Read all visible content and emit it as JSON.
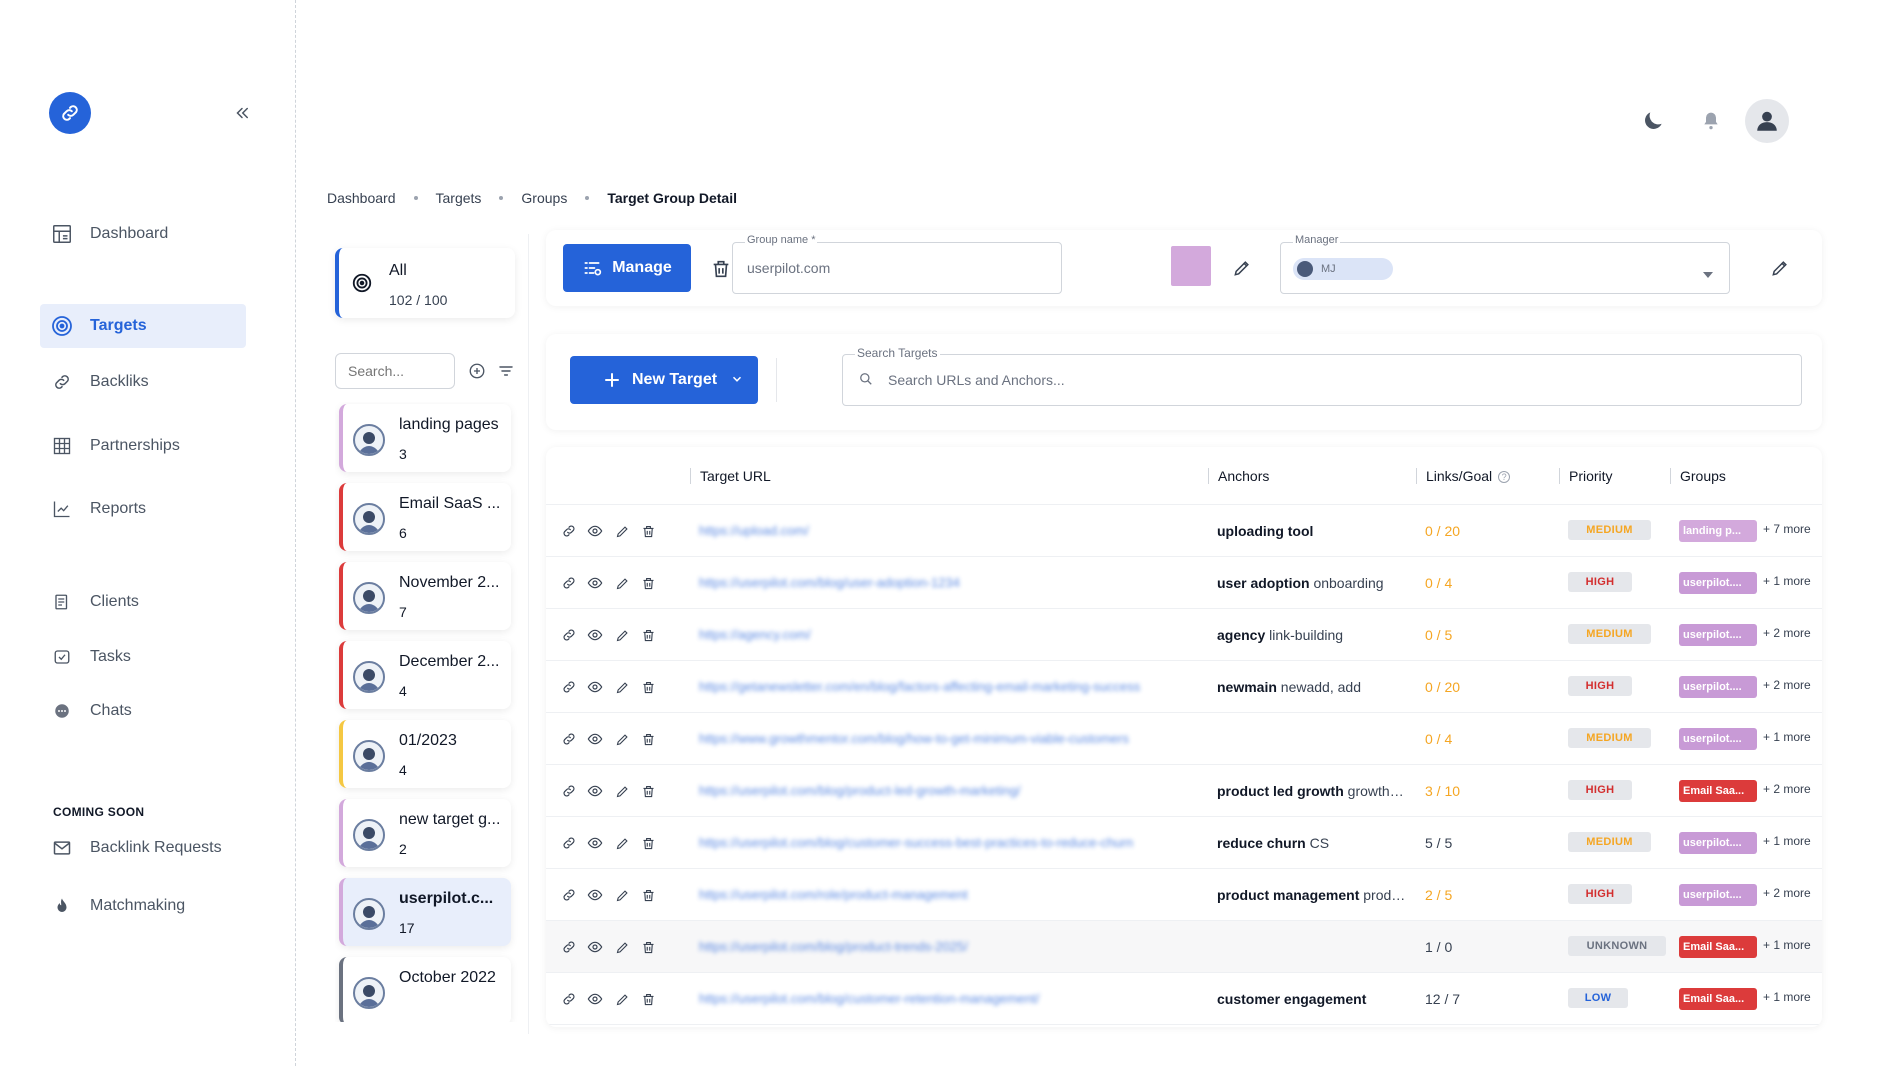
{
  "sidebar": {
    "items": [
      {
        "label": "Dashboard",
        "icon": "dashboard-icon"
      },
      {
        "label": "Targets",
        "icon": "target-icon",
        "active": true
      },
      {
        "label": "Backliks",
        "icon": "link-icon"
      },
      {
        "label": "Partnerships",
        "icon": "grid-icon"
      },
      {
        "label": "Reports",
        "icon": "chart-icon"
      },
      {
        "label": "Clients",
        "icon": "clients-icon"
      },
      {
        "label": "Tasks",
        "icon": "tasks-icon"
      },
      {
        "label": "Chats",
        "icon": "chat-icon"
      }
    ],
    "coming_soon_title": "COMING SOON",
    "coming_soon": [
      {
        "label": "Backlink Requests",
        "icon": "mail-icon"
      },
      {
        "label": "Matchmaking",
        "icon": "flame-icon"
      }
    ]
  },
  "breadcrumb": [
    "Dashboard",
    "Targets",
    "Groups",
    "Target Group Detail"
  ],
  "groups": {
    "all_label": "All",
    "all_count": "102 / 100",
    "search_placeholder": "Search...",
    "list": [
      {
        "name": "landing pages",
        "count": "3",
        "color": "#d3a9dc"
      },
      {
        "name": "Email SaaS ...",
        "count": "6",
        "color": "#dc3b3b"
      },
      {
        "name": "November 2...",
        "count": "7",
        "color": "#dc3b3b"
      },
      {
        "name": "December 2...",
        "count": "4",
        "color": "#dc3b3b"
      },
      {
        "name": "01/2023",
        "count": "4",
        "color": "#f5c842"
      },
      {
        "name": "new target g...",
        "count": "2",
        "color": "#d3a9dc"
      },
      {
        "name": "userpilot.c...",
        "count": "17",
        "color": "#d3a9dc",
        "selected": true
      },
      {
        "name": "October 2022",
        "count": "",
        "color": "#6b7280"
      }
    ]
  },
  "header": {
    "manage_label": "Manage",
    "group_name_label": "Group name *",
    "group_name_value": "userpilot.com",
    "group_color": "#d3a9dc",
    "manager_label": "Manager",
    "manager_value": "MJ"
  },
  "actions": {
    "new_target_label": "New Target",
    "search_label": "Search Targets",
    "search_placeholder": "Search URLs and Anchors..."
  },
  "table": {
    "columns": [
      "Target URL",
      "Anchors",
      "Links/Goal",
      "Priority",
      "Groups"
    ],
    "rows": [
      {
        "url": "https://upload.com/",
        "anchor_bold": "uploading tool",
        "anchor_rest": "",
        "links": "0 / 20",
        "links_color": "#f5a623",
        "priority": "MEDIUM",
        "group": "landing p...",
        "group_color": "#d3a9dc",
        "more": "+ 7 more"
      },
      {
        "url": "https://userpilot.com/blog/user-adoption-1234",
        "anchor_bold": "user adoption",
        "anchor_rest": " onboarding",
        "links": "0 / 4",
        "links_color": "#f5a623",
        "priority": "HIGH",
        "group": "userpilot....",
        "group_color": "#c89ad6",
        "more": "+ 1 more"
      },
      {
        "url": "https://agency.com/",
        "anchor_bold": "agency",
        "anchor_rest": " link-building",
        "links": "0 / 5",
        "links_color": "#f5a623",
        "priority": "MEDIUM",
        "group": "userpilot....",
        "group_color": "#c89ad6",
        "more": "+ 2 more"
      },
      {
        "url": "https://getanewsletter.com/en/blog/factors-affecting-email-marketing-success",
        "anchor_bold": "newmain",
        "anchor_rest": " newadd, add",
        "links": "0 / 20",
        "links_color": "#f5a623",
        "priority": "HIGH",
        "group": "userpilot....",
        "group_color": "#c89ad6",
        "more": "+ 2 more"
      },
      {
        "url": "https://www.growthmentor.com/blog/how-to-get-minimum-viable-customers",
        "anchor_bold": "",
        "anchor_rest": "",
        "links": "0 / 4",
        "links_color": "#f5a623",
        "priority": "MEDIUM",
        "group": "userpilot....",
        "group_color": "#c89ad6",
        "more": "+ 1 more"
      },
      {
        "url": "https://userpilot.com/blog/product-led-growth-marketing/",
        "anchor_bold": "product led growth",
        "anchor_rest": " growth marketing",
        "links": "3 / 10",
        "links_color": "#f5a623",
        "priority": "HIGH",
        "group": "Email Saa...",
        "group_color": "#dc3b3b",
        "more": "+ 2 more"
      },
      {
        "url": "https://userpilot.com/blog/customer-success-best-practices-to-reduce-churn",
        "anchor_bold": "reduce churn",
        "anchor_rest": " CS",
        "links": "5 / 5",
        "links_color": "#374151",
        "priority": "MEDIUM",
        "group": "userpilot....",
        "group_color": "#c89ad6",
        "more": "+ 1 more"
      },
      {
        "url": "https://userpilot.com/role/product-management",
        "anchor_bold": "product management",
        "anchor_rest": " product",
        "links": "2 / 5",
        "links_color": "#f5a623",
        "priority": "HIGH",
        "group": "userpilot....",
        "group_color": "#c89ad6",
        "more": "+ 2 more"
      },
      {
        "url": "https://userpilot.com/blog/product-trends-2025/",
        "anchor_bold": "",
        "anchor_rest": "",
        "links": "1 / 0",
        "links_color": "#374151",
        "priority": "UNKNOWN",
        "group": "Email Saa...",
        "group_color": "#dc3b3b",
        "more": "+ 1 more",
        "greyed": true
      },
      {
        "url": "https://userpilot.com/blog/customer-retention-management/",
        "anchor_bold": "customer engagement",
        "anchor_rest": "",
        "links": "12 / 7",
        "links_color": "#374151",
        "priority": "LOW",
        "group": "Email Saa...",
        "group_color": "#dc3b3b",
        "more": "+ 1 more"
      }
    ]
  },
  "colors": {
    "accent": "#2563d9",
    "high": "#d32f2f",
    "medium": "#f5a623"
  }
}
